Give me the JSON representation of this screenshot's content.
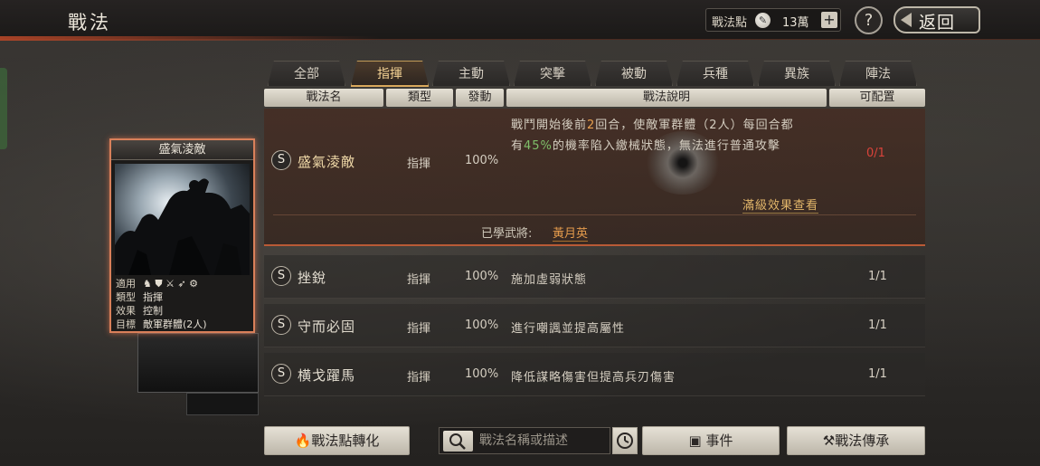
{
  "header": {
    "title": "戰法",
    "points_label": "戰法點",
    "points_value": "13萬",
    "plus": "+",
    "help": "?",
    "back": "返回"
  },
  "tabs": [
    {
      "label": "全部",
      "active": false
    },
    {
      "label": "指揮",
      "active": true
    },
    {
      "label": "主動",
      "active": false
    },
    {
      "label": "突擊",
      "active": false
    },
    {
      "label": "被動",
      "active": false
    },
    {
      "label": "兵種",
      "active": false
    },
    {
      "label": "異族",
      "active": false
    },
    {
      "label": "陣法",
      "active": false
    }
  ],
  "columns": {
    "name": "戰法名",
    "type": "類型",
    "trigger": "發動",
    "desc": "戰法說明",
    "config": "可配置"
  },
  "expanded": {
    "grade": "S",
    "name": "盛氣淩敵",
    "type": "指揮",
    "trigger": "100%",
    "desc_line1_a": "戰鬥開始後前",
    "desc_line1_num": "2",
    "desc_line1_b": "回合，使敵軍群體（2人）每回合都",
    "desc_line2_a": "有",
    "desc_line2_pct": "45%",
    "desc_line2_b": "的機率陷入繳械狀態，無法進行普通攻擊",
    "config": "0/1",
    "max_effect_link": "滿級效果查看",
    "learned_label": "已學武將:",
    "learned_general": "黃月英"
  },
  "rows": [
    {
      "grade": "S",
      "name": "挫銳",
      "type": "指揮",
      "trigger": "100%",
      "desc": "施加虛弱狀態",
      "config": "1/1"
    },
    {
      "grade": "S",
      "name": "守而必固",
      "type": "指揮",
      "trigger": "100%",
      "desc": "進行嘲諷並提高屬性",
      "config": "1/1"
    },
    {
      "grade": "S",
      "name": "横戈躍馬",
      "type": "指揮",
      "trigger": "100%",
      "desc": "降低謀略傷害但提高兵刃傷害",
      "config": "1/1"
    }
  ],
  "card": {
    "title": "盛氣淩敵",
    "apply_label": "適用",
    "type_label": "類型",
    "type_value": "指揮",
    "effect_label": "效果",
    "effect_value": "控制",
    "target_label": "目標",
    "target_value": "敵軍群體(2人)"
  },
  "bottom": {
    "convert_button": "戰法點轉化",
    "search_placeholder": "戰法名稱或描述",
    "event_button": "事件",
    "inherit_button": "戰法傳承"
  },
  "colors": {
    "accent_gold": "#f3d193",
    "highlight_green": "#7fbf6a",
    "warn_red": "#d9433a",
    "border_orange": "#d9805a"
  }
}
